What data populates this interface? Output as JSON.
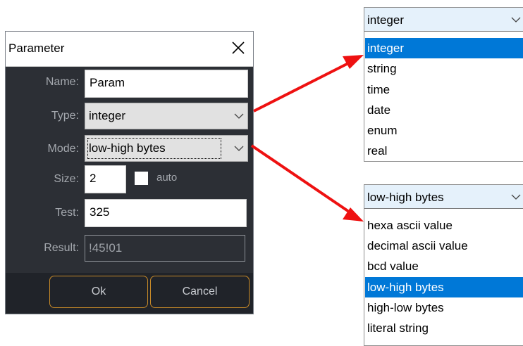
{
  "dialog": {
    "title": "Parameter",
    "name_label": "Name:",
    "name_value": "Param",
    "type_label": "Type:",
    "type_value": "integer",
    "mode_label": "Mode:",
    "mode_value": "low-high bytes",
    "size_label": "Size:",
    "size_value": "2",
    "auto_label": "auto",
    "auto_checked": false,
    "test_label": "Test:",
    "test_value": "325",
    "result_label": "Result:",
    "result_value": "!45!01",
    "ok_label": "Ok",
    "cancel_label": "Cancel"
  },
  "type_dropdown": {
    "current": "integer",
    "options": [
      "integer",
      "string",
      "time",
      "date",
      "enum",
      "real"
    ],
    "selected": "integer"
  },
  "mode_dropdown": {
    "current": "low-high bytes",
    "options": [
      "hexa ascii value",
      "decimal ascii value",
      "bcd value",
      "low-high bytes",
      "high-low bytes",
      "literal string"
    ],
    "selected": "low-high bytes"
  },
  "colors": {
    "dialog_bg": "#2c2f35",
    "button_border": "#c88a28",
    "selection": "#0078d7",
    "arrow": "#ee1111"
  },
  "icons": {
    "close": "close-icon",
    "dropdown": "chevron-down-icon",
    "annotation": "red-arrow"
  }
}
